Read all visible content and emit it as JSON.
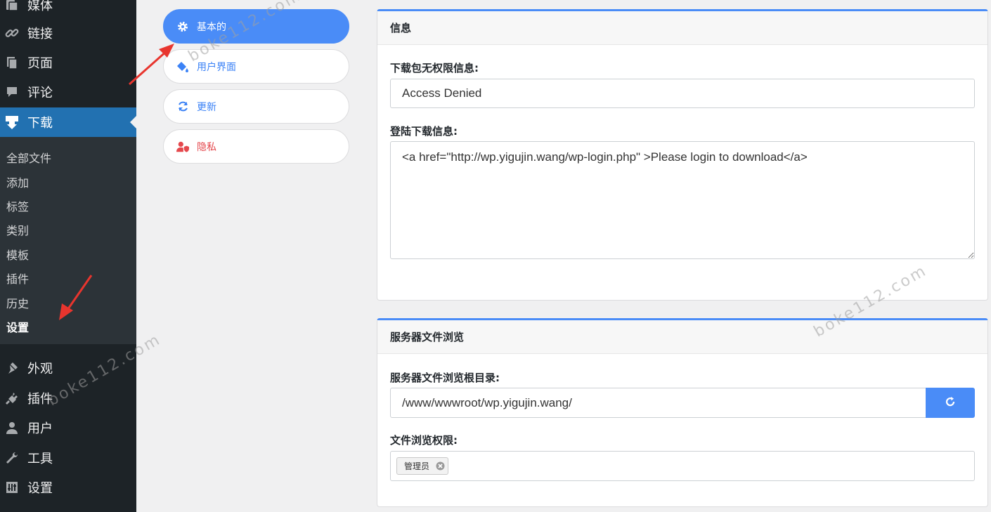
{
  "sidebar": {
    "menu": [
      {
        "label": "媒体",
        "icon": "media-icon"
      },
      {
        "label": "链接",
        "icon": "link-icon"
      },
      {
        "label": "页面",
        "icon": "pages-icon"
      },
      {
        "label": "评论",
        "icon": "comments-icon"
      },
      {
        "label": "下载",
        "icon": "download-icon"
      },
      {
        "label": "外观",
        "icon": "appearance-icon"
      },
      {
        "label": "插件",
        "icon": "plugins-icon"
      },
      {
        "label": "用户",
        "icon": "users-icon"
      },
      {
        "label": "工具",
        "icon": "tools-icon"
      },
      {
        "label": "设置",
        "icon": "settings-icon"
      }
    ],
    "submenu": [
      "全部文件",
      "添加",
      "标签",
      "类别",
      "模板",
      "插件",
      "历史",
      "设置"
    ]
  },
  "tabs": [
    {
      "label": "基本的",
      "icon": "gear-icon"
    },
    {
      "label": "用户界面",
      "icon": "paint-bucket-icon"
    },
    {
      "label": "更新",
      "icon": "sync-icon"
    },
    {
      "label": "隐私",
      "icon": "user-shield-icon"
    }
  ],
  "info_panel": {
    "title": "信息",
    "no_permission_label": "下载包无权限信息:",
    "no_permission_value": "Access Denied",
    "login_label": "登陆下载信息:",
    "login_value": "<a href=\"http://wp.yigujin.wang/wp-login.php\" >Please login to download</a>"
  },
  "browser_panel": {
    "title": "服务器文件浏览",
    "root_label": "服务器文件浏览根目录:",
    "root_value": "/www/wwwroot/wp.yigujin.wang/",
    "refresh_icon": "refresh-icon",
    "permission_label": "文件浏览权限:",
    "permission_tags": [
      "管理员"
    ]
  },
  "watermark": "boke112.com",
  "colors": {
    "accent": "#4a8cf7",
    "wp_blue": "#2271b1",
    "sidebar_bg": "#1d2327",
    "submenu_bg": "#2c3338",
    "privacy_red": "#e5484d",
    "arrow_red": "#e8352e"
  }
}
